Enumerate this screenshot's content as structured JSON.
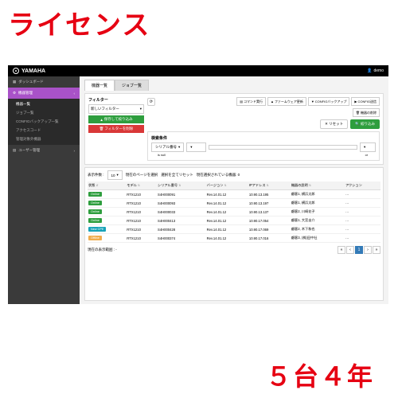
{
  "overlay": {
    "top_title": "ライセンス",
    "bottom_title": "５台４年"
  },
  "topbar": {
    "brand": "YAMAHA",
    "user": "demo"
  },
  "sidebar": {
    "items": [
      {
        "icon": "▦",
        "label": "ダッシュボード"
      },
      {
        "icon": "⚙",
        "label": "機器管理",
        "active": true
      },
      {
        "icon": "▤",
        "label": "ユーザー管理"
      }
    ],
    "sub": [
      "機器一覧",
      "ジョブ一覧",
      "CONFIGバックアップ一覧",
      "アクセスコード",
      "管理対象外機器"
    ]
  },
  "tabs": [
    "機器一覧",
    "ジョブ一覧"
  ],
  "filter": {
    "title": "フィルター",
    "new_filter": "新しいフィルター",
    "save": "保存して絞り込み",
    "delete": "フィルターを削除"
  },
  "action_buttons": [
    "コマンド実行",
    "ファームウェア更新",
    "CONFIGバックアップ",
    "CONFIG送信"
  ],
  "device_del": "機器の削除",
  "reset": "リセット",
  "apply": "絞り込み",
  "search": {
    "title": "検索条件",
    "field": "シリアル番号",
    "op1": "is null",
    "op2": "or"
  },
  "table_ctrl": {
    "count_label": "表示件数 :",
    "count": "10",
    "sel_page": "現在のページを選択",
    "sel_clear": "選択を全てリセット",
    "sel_info": "現在選択されている機器: 0"
  },
  "columns": [
    "状態",
    "モデル",
    "シリアル番号",
    "バージョン",
    "IPアドレス",
    "機器の説明",
    "アクション"
  ],
  "rows": [
    {
      "status": "Online",
      "cls": "b-on",
      "model": "RTX1210",
      "serial": "S4H000091",
      "ver": "Rev.14.01.12",
      "ip": "10.90.13.195",
      "desc": "顧客1, 横浜太郎"
    },
    {
      "status": "Online",
      "cls": "b-on",
      "model": "RTX1210",
      "serial": "S4H000093",
      "ver": "Rev.14.01.12",
      "ip": "10.90.13.197",
      "desc": "顧客1, 横浜太郎"
    },
    {
      "status": "Online",
      "cls": "b-on",
      "model": "RTX1210",
      "serial": "S4H000033",
      "ver": "Rev.14.01.12",
      "ip": "10.90.13.137",
      "desc": "顧客2, 川崎花子"
    },
    {
      "status": "Online",
      "cls": "b-on",
      "model": "RTX1210",
      "serial": "S4H000413",
      "ver": "Rev.14.01.12",
      "ip": "10.90.17.054",
      "desc": "顧客1, 大宮圭介"
    },
    {
      "status": "New CPE",
      "cls": "b-new",
      "model": "RTX1210",
      "serial": "S4H000428",
      "ver": "Rev.14.01.12",
      "ip": "10.90.17.069",
      "desc": "顧客2, 木下和也"
    },
    {
      "status": "Offline",
      "cls": "b-off",
      "model": "RTX1210",
      "serial": "S4H000374",
      "ver": "Rev.14.01.12",
      "ip": "10.90.17.016",
      "desc": "顧客3, (株)田中社"
    }
  ],
  "pager": {
    "info": "現在の表示範囲 :  - ",
    "page": "1"
  }
}
